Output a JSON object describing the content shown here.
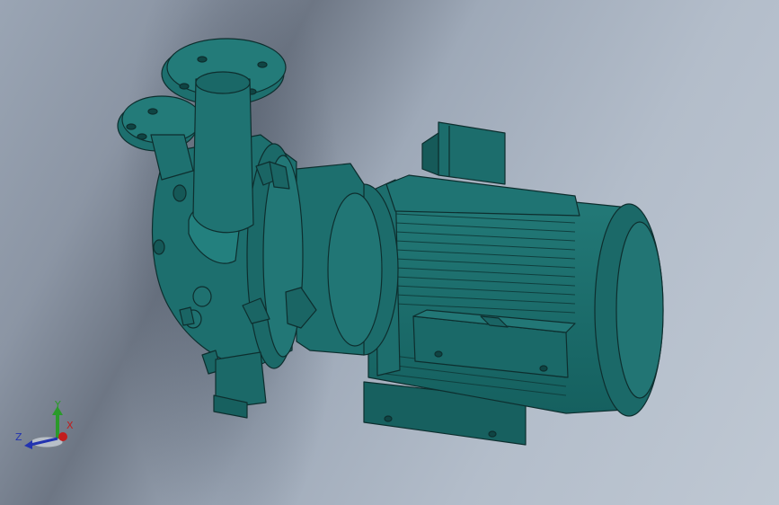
{
  "viewport": {
    "background_colors": [
      "#9aa5b4",
      "#6d7684",
      "#bfc8d3"
    ],
    "model_color": "#1e6b6a",
    "edge_color": "#0d2e2e"
  },
  "model": {
    "name": "liquid-ring-vacuum-pump"
  },
  "triad": {
    "x_label": "X",
    "y_label": "Y",
    "z_label": "Z",
    "x_color": "#c21d1d",
    "y_color": "#2a9a2a",
    "z_color": "#2233b0"
  }
}
